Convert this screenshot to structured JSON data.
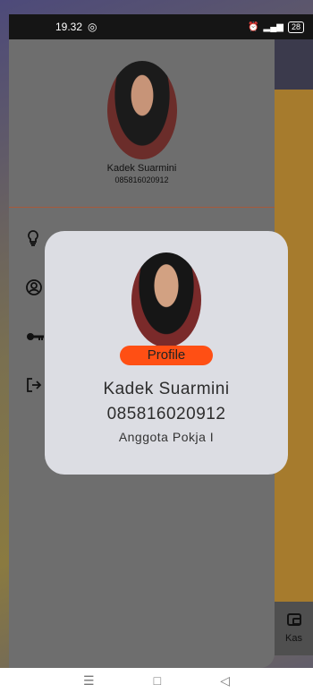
{
  "status_bar": {
    "time": "19.32",
    "battery": "28"
  },
  "drawer": {
    "user_name": "Kadek Suarmini",
    "user_phone": "085816020912"
  },
  "dialog": {
    "profile_label": "Profile",
    "name": "Kadek Suarmini",
    "phone": "085816020912",
    "role": "Anggota Pokja I"
  },
  "background": {
    "kas_label": "Kas"
  },
  "icons": {
    "whatsapp": "whatsapp-icon",
    "bulb": "lightbulb-icon",
    "account": "account-circle-icon",
    "key": "key-icon",
    "logout": "logout-icon",
    "wallet": "wallet-icon"
  },
  "colors": {
    "accent": "#ff4f14",
    "drawer": "#6e6e6e",
    "dialog": "#dcdde3"
  }
}
